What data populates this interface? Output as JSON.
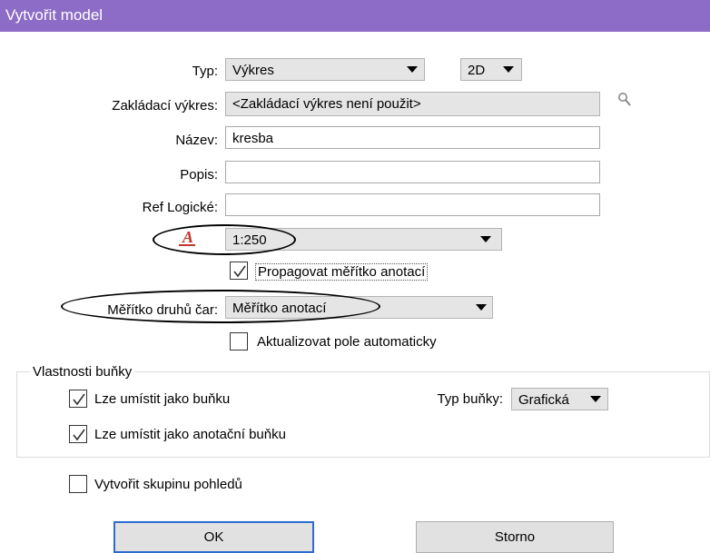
{
  "window": {
    "title": "Vytvořit model"
  },
  "type": {
    "label": "Typ:",
    "value": "Výkres",
    "mode": "2D"
  },
  "seed": {
    "label": "Zakládací výkres:",
    "value": "<Zakládací výkres není použit>"
  },
  "name": {
    "label": "Název:",
    "value": "kresba"
  },
  "description": {
    "label": "Popis:",
    "value": ""
  },
  "logical": {
    "label": "Ref Logické:",
    "value": ""
  },
  "annotation_scale": {
    "value": "1:250",
    "icon_char": "A"
  },
  "propagate": {
    "label": "Propagovat měřítko anotací",
    "checked": true
  },
  "line_style_scale": {
    "label": "Měřítko druhů čar:",
    "value": "Měřítko anotací"
  },
  "auto_update": {
    "label": "Aktualizovat pole automaticky",
    "checked": false
  },
  "cell_props": {
    "legend": "Vlastnosti buňky",
    "place_as_cell": {
      "label": "Lze umístit jako buňku",
      "checked": true
    },
    "place_as_annotation_cell": {
      "label": "Lze umístit jako anotační buňku",
      "checked": true
    },
    "cell_type": {
      "label": "Typ buňky:",
      "value": "Grafická"
    }
  },
  "create_view_group": {
    "label": "Vytvořit skupinu pohledů",
    "checked": false
  },
  "buttons": {
    "ok": "OK",
    "cancel": "Storno"
  },
  "colors": {
    "titlebar": "#8d6cc7",
    "default_button_border": "#2d6bcf"
  }
}
